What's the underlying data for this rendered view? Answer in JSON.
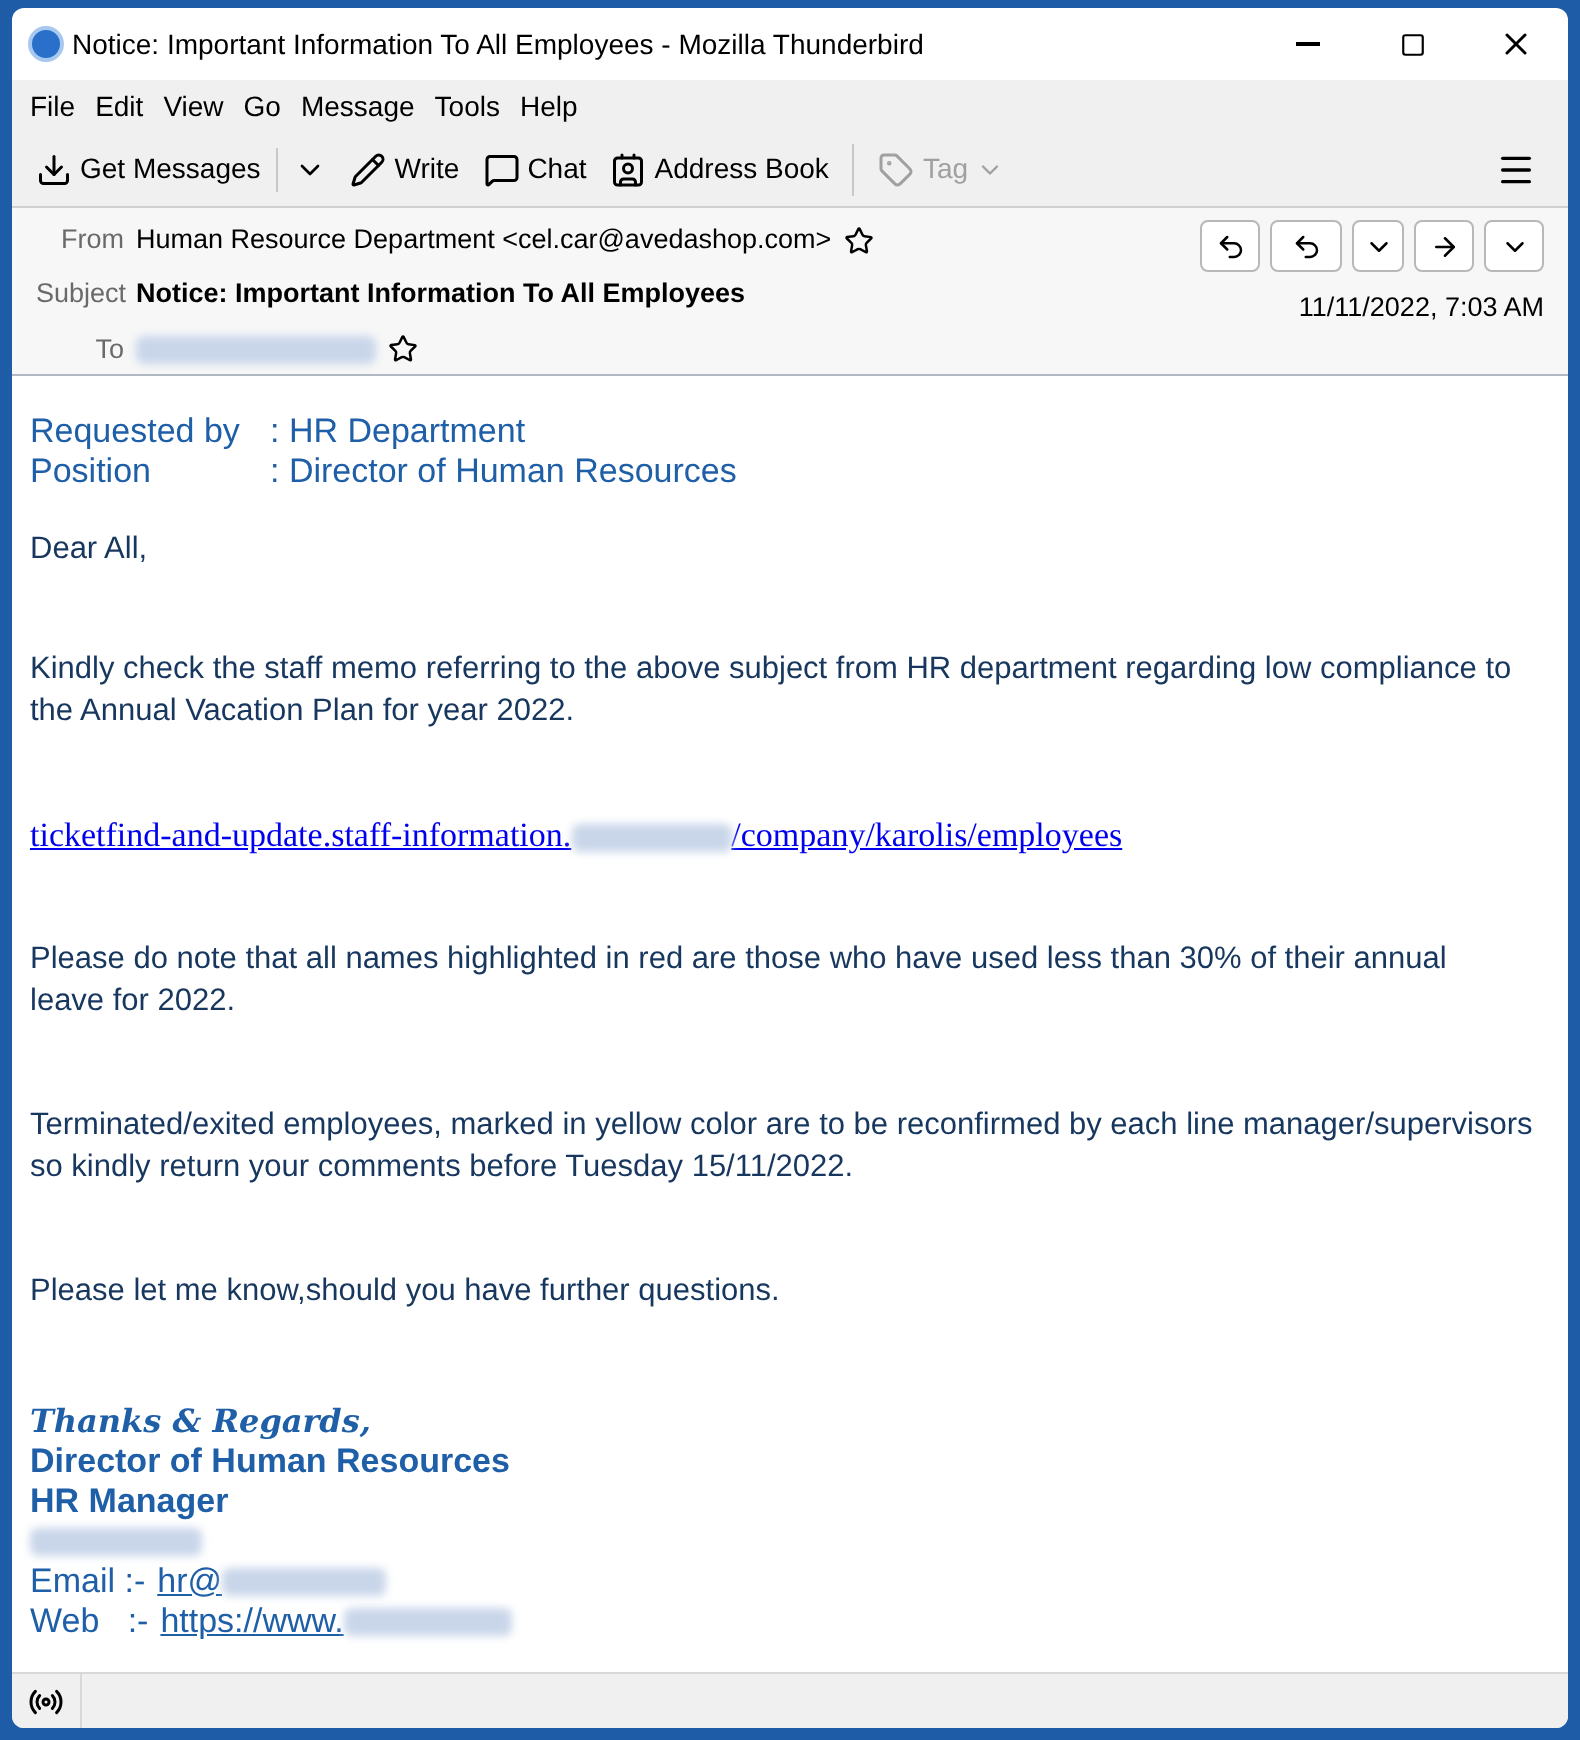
{
  "window": {
    "title": "Notice: Important Information To All Employees - Mozilla Thunderbird"
  },
  "menu": [
    "File",
    "Edit",
    "View",
    "Go",
    "Message",
    "Tools",
    "Help"
  ],
  "toolbar": [
    {
      "label": "Get Messages",
      "kind": "get",
      "disabled": false
    },
    {
      "label": "Write",
      "kind": "write",
      "disabled": false
    },
    {
      "label": "Chat",
      "kind": "chat",
      "disabled": false
    },
    {
      "label": "Address Book",
      "kind": "book",
      "disabled": false
    },
    {
      "label": "Tag",
      "kind": "tag",
      "disabled": true
    }
  ],
  "header": {
    "from_label": "From",
    "from": "Human Resource Department <cel.car@avedashop.com>",
    "subject_label": "Subject",
    "subject": "Notice: Important Information To All Employees",
    "to_label": "To",
    "date": "11/11/2022, 7:03 AM"
  },
  "body": {
    "requested": [
      {
        "label": "Requested by",
        "value": ": HR Department"
      },
      {
        "label": "Position",
        "value": ": Director of Human Resources"
      }
    ],
    "greeting": "Dear All,",
    "p1": "Kindly check the staff memo referring to the above subject from HR department regarding low compliance to the Annual Vacation Plan for year 2022.",
    "link_start": "ticketfind-and-update.staff-information.",
    "link_end": "/company/karolis/employees",
    "p2": "Please do note that all names highlighted in red are those who have used less than 30% of their annual leave for 2022.",
    "p3": "Terminated/exited employees, marked in yellow color are to be reconfirmed by each line manager/supervisors so kindly return your comments before Tuesday 15/11/2022.",
    "p4": "Please let me know,should you have further questions.",
    "thanks": "Thanks & Regards,",
    "sig": [
      "Director of Human Resources",
      "HR Manager"
    ],
    "email_label": "Email :-",
    "email_link": "hr@",
    "web_label": "Web   :-",
    "web_link": "https://www."
  }
}
